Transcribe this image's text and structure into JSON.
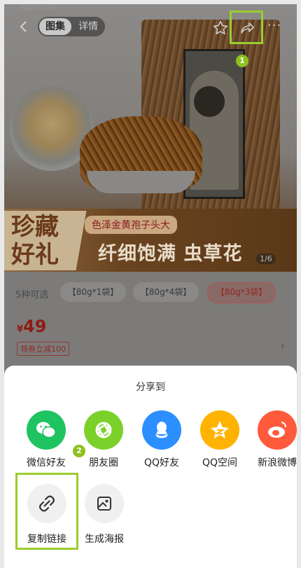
{
  "top_bar": {
    "small_text": "中国区域 218·10",
    "tab_gallery": "图集",
    "tab_detail": "详情",
    "more": "···"
  },
  "banner": {
    "title_line1": "珍藏",
    "title_line2": "好礼",
    "subtitle": "色泽金黄孢子头大",
    "main_text": "纤细饱满 虫草花",
    "page_indicator": "1/6"
  },
  "options": {
    "count_label": "5种可选",
    "chips": [
      "【80g*1袋】",
      "【80g*4袋】",
      "【80g*3袋】"
    ],
    "selected_chip_index": 2
  },
  "price": {
    "currency": "¥",
    "amount": "49",
    "coupon": "领券立减100"
  },
  "share_sheet": {
    "title": "分享到",
    "apps": [
      {
        "label": "微信好友",
        "icon": "wechat-icon",
        "color": "#1fc461"
      },
      {
        "label": "朋友圈",
        "icon": "moments-icon",
        "color": "#7bd12a"
      },
      {
        "label": "QQ好友",
        "icon": "qq-icon",
        "color": "#2b8fff"
      },
      {
        "label": "QQ空间",
        "icon": "qzone-icon",
        "color": "#ffb300"
      },
      {
        "label": "新浪微博",
        "icon": "weibo-icon",
        "color": "#ff5a3c"
      }
    ],
    "tools": [
      {
        "label": "复制链接",
        "icon": "link-icon"
      },
      {
        "label": "生成海报",
        "icon": "poster-icon"
      }
    ]
  },
  "annotations": [
    "1",
    "2"
  ],
  "colors": {
    "highlight": "#9acd2e",
    "badge": "#8cc21f",
    "price_red": "#e0251b"
  }
}
